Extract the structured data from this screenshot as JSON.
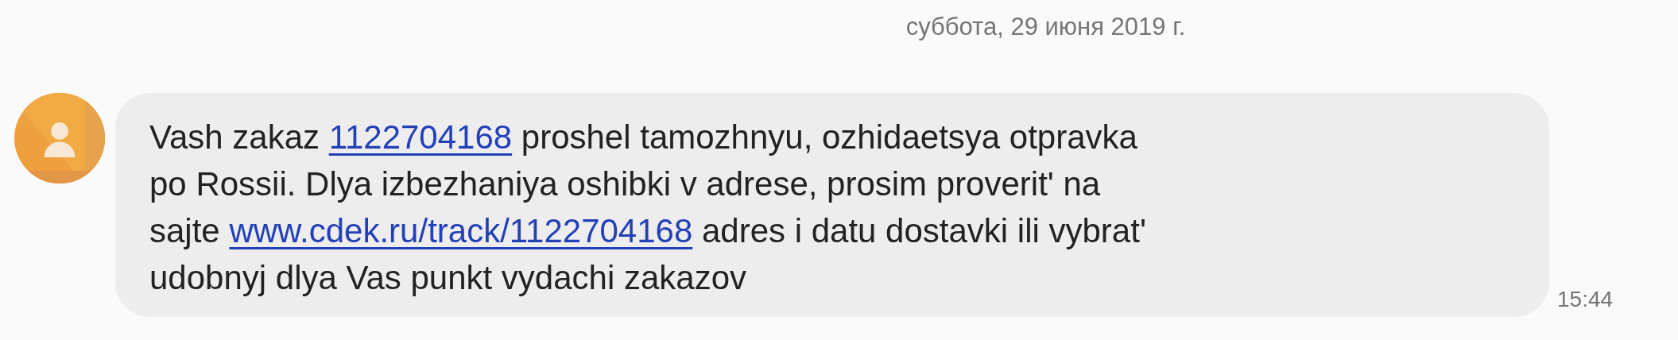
{
  "date_header": "суббота, 29 июня 2019 г.",
  "message": {
    "lines": [
      [
        {
          "kind": "text",
          "text": "Vash zakaz "
        },
        {
          "kind": "link",
          "text": "1122704168"
        },
        {
          "kind": "text",
          "text": " proshel tamozhnyu, ozhidaetsya otpravka"
        }
      ],
      [
        {
          "kind": "text",
          "text": "po Rossii. Dlya izbezhaniya oshibki v adrese, prosim proverit' na"
        }
      ],
      [
        {
          "kind": "text",
          "text": "sajte "
        },
        {
          "kind": "link",
          "text": "www.cdek.ru/track/1122704168"
        },
        {
          "kind": "text",
          "text": " adres i datu dostavki ili vybrat'"
        }
      ],
      [
        {
          "kind": "text",
          "text": "udobnyj dlya Vas punkt vydachi zakazov"
        }
      ]
    ],
    "time": "15:44"
  }
}
